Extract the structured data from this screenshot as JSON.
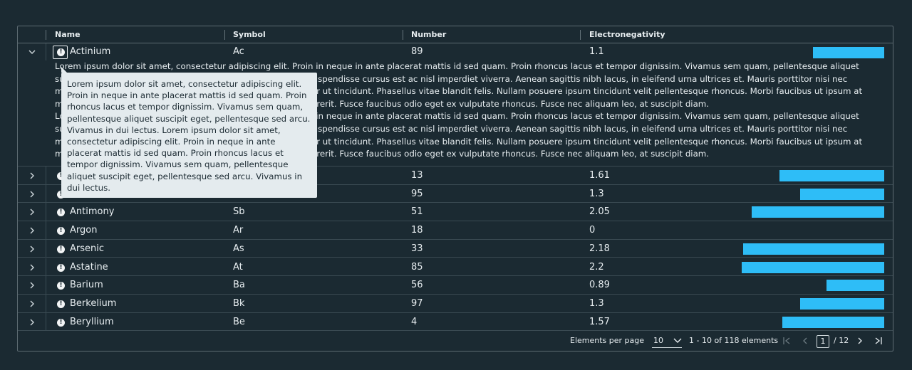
{
  "table": {
    "columns": [
      "Name",
      "Symbol",
      "Number",
      "Electronegativity"
    ],
    "expanded_row": {
      "name": "Actinium",
      "symbol": "Ac",
      "number": "89",
      "electronegativity": "1.1",
      "bar_fraction": 0.4,
      "detail_lines": [
        "Lorem ipsum dolor sit amet, consectetur adipiscing elit. Proin in neque in ante placerat mattis id sed quam. Proin rhoncus lacus et tempor dignissim. Vivamus sem quam, pellentesque aliquet",
        "suscipit eget, pellentesque sed arcu. Vivamus in dui lectus. Suspendisse cursus est ac nisl imperdiet viverra. Aenean sagittis nibh lacus, in eleifend urna ultrices et. Mauris porttitor nisi nec",
        "magna rutrum, vitae fringilla purus pellentesque. Nunc tempor ut tincidunt. Phasellus vitae blandit felis. Nullam posuere ipsum tincidunt velit pellentesque rhoncus. Morbi faucibus ut ipsum at",
        "mattis. Vestibulum ante ipsum primis in faucibus. Donec hendrerit. Fusce faucibus odio eget ex vulputate rhoncus. Fusce nec aliquam leo, at suscipit diam.",
        "Lorem ipsum dolor sit amet, consectetur adipiscing elit. Proin in neque in ante placerat mattis id sed quam. Proin rhoncus lacus et tempor dignissim. Vivamus sem quam, pellentesque aliquet",
        "suscipit eget, pellentesque sed arcu. Vivamus in dui lectus. Suspendisse cursus est ac nisl imperdiet viverra. Aenean sagittis nibh lacus, in eleifend urna ultrices et. Mauris porttitor nisi nec",
        "magna rutrum, vitae fringilla purus pellentesque. Nunc tempor ut tincidunt. Phasellus vitae blandit felis. Nullam posuere ipsum tincidunt velit pellentesque rhoncus. Morbi faucibus ut ipsum at",
        "mattis. Vestibulum ante ipsum primis in faucibus. Donec hendrerit. Fusce faucibus odio eget ex vulputate rhoncus. Fusce nec aliquam leo, at suscipit diam."
      ]
    },
    "rows": [
      {
        "name": "",
        "symbol": "",
        "number": "13",
        "electronegativity": "1.61",
        "bar_fraction": 0.586
      },
      {
        "name": "",
        "symbol": "",
        "number": "95",
        "electronegativity": "1.3",
        "bar_fraction": 0.473
      },
      {
        "name": "Antimony",
        "symbol": "Sb",
        "number": "51",
        "electronegativity": "2.05",
        "bar_fraction": 0.745
      },
      {
        "name": "Argon",
        "symbol": "Ar",
        "number": "18",
        "electronegativity": "0",
        "bar_fraction": 0
      },
      {
        "name": "Arsenic",
        "symbol": "As",
        "number": "33",
        "electronegativity": "2.18",
        "bar_fraction": 0.793
      },
      {
        "name": "Astatine",
        "symbol": "At",
        "number": "85",
        "electronegativity": "2.2",
        "bar_fraction": 0.8
      },
      {
        "name": "Barium",
        "symbol": "Ba",
        "number": "56",
        "electronegativity": "0.89",
        "bar_fraction": 0.324
      },
      {
        "name": "Berkelium",
        "symbol": "Bk",
        "number": "97",
        "electronegativity": "1.3",
        "bar_fraction": 0.473
      },
      {
        "name": "Beryllium",
        "symbol": "Be",
        "number": "4",
        "electronegativity": "1.57",
        "bar_fraction": 0.571
      }
    ]
  },
  "tooltip": {
    "text": "Lorem ipsum dolor sit amet, consectetur adipiscing elit. Proin in neque in ante placerat mattis id sed quam. Proin rhoncus lacus et tempor dignissim. Vivamus sem quam, pellentesque aliquet suscipit eget, pellentesque sed arcu. Vivamus in dui lectus. Lorem ipsum dolor sit amet, consectetur adipiscing elit. Proin in neque in ante placerat mattis id sed quam. Proin rhoncus lacus et tempor dignissim. Vivamus sem quam, pellentesque aliquet suscipit eget, pellentesque sed arcu. Vivamus in dui lectus."
  },
  "footer": {
    "per_page_label": "Elements per page",
    "per_page_value": "10",
    "range_label": "1 - 10 of 118 elements",
    "current_page": "1",
    "total_pages": "/ 12"
  },
  "colors": {
    "background": "#1b2a32",
    "bar": "#2ebdf7",
    "tooltip_bg": "#e4ebee"
  },
  "icons": {
    "row_status": "error-icon",
    "expand": "chevron-right-icon",
    "collapse": "chevron-down-icon",
    "first_page": "first-page-icon",
    "prev_page": "chevron-left-icon",
    "next_page": "chevron-right-icon",
    "last_page": "last-page-icon",
    "dropdown": "chevron-down-icon"
  }
}
